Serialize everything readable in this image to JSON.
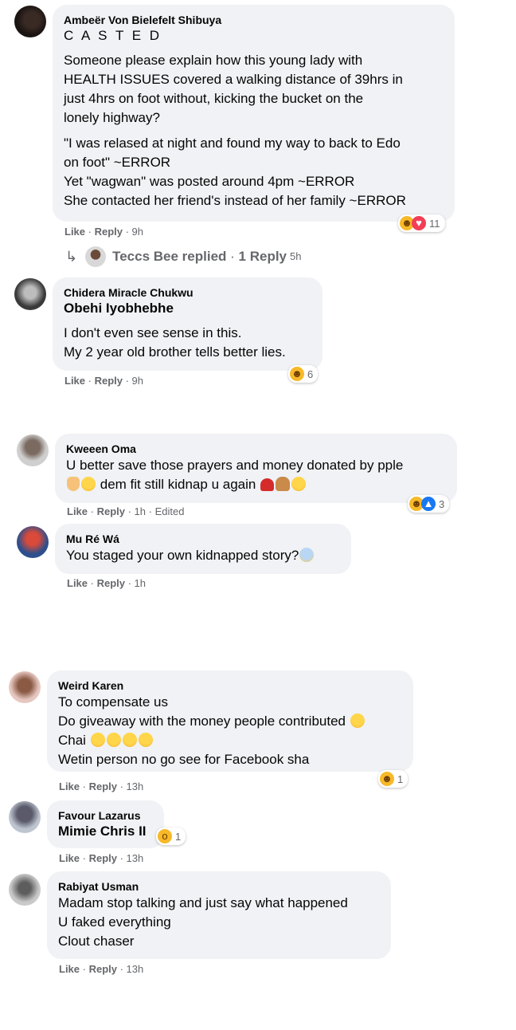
{
  "comments": [
    {
      "author": "Ambeër Von Bielefelt Shibuya",
      "tag": "C A S T E D",
      "paragraphs": [
        [
          "Someone please explain how this young lady with",
          "HEALTH ISSUES covered a walking distance of 39hrs in",
          "just 4hrs on foot without, kicking the bucket on the",
          "lonely highway?"
        ],
        [
          "\"I was relased at night and found my way to back to Edo",
          "on foot\" ~ERROR",
          "Yet \"wagwan\" was posted around 4pm ~ERROR",
          "She contacted her friend's instead of her family ~ERROR"
        ]
      ],
      "like": "Like",
      "reply": "Reply",
      "time": "9h",
      "reactions": "11",
      "replied": {
        "name": "Teccs Bee replied",
        "count": "1 Reply",
        "time": "5h"
      }
    },
    {
      "author": "Chidera Miracle Chukwu",
      "tag": "Obehi Iyobhebhe",
      "lines": [
        "I don't even see sense in this.",
        "My 2 year old brother tells better lies."
      ],
      "like": "Like",
      "reply": "Reply",
      "time": "9h",
      "reactions": "6"
    },
    {
      "author": "Kweeen Oma",
      "line1": "U better save those prayers and money donated by pple",
      "line2": "dem fit still kidnap u again",
      "like": "Like",
      "reply": "Reply",
      "time": "1h",
      "edited": "Edited",
      "reactions": "3"
    },
    {
      "author": "Mu Ré Wá",
      "line1": "You staged your own kidnapped story?",
      "like": "Like",
      "reply": "Reply",
      "time": "1h"
    },
    {
      "author": "Weird Karen",
      "lines": [
        "To compensate us",
        "Do giveaway with the money people contributed",
        "Chai",
        "Wetin person no go see for Facebook sha"
      ],
      "like": "Like",
      "reply": "Reply",
      "time": "13h",
      "reactions": "1"
    },
    {
      "author": "Favour Lazarus",
      "tag": "Mimie Chris II",
      "like": "Like",
      "reply": "Reply",
      "time": "13h",
      "reactions": "1"
    },
    {
      "author": "Rabiyat Usman",
      "lines": [
        "Madam stop talking and just say what happened",
        "U faked everything",
        "Clout chaser"
      ],
      "like": "Like",
      "reply": "Reply",
      "time": "13h"
    }
  ],
  "colors": {
    "bubble": "#f0f2f5",
    "meta": "#65676b",
    "text": "#050505",
    "love": "#f33e58",
    "like": "#1877f2",
    "haha": "#f7b928"
  },
  "icons": [
    "haha-reaction-icon",
    "love-reaction-icon",
    "like-reaction-icon",
    "wow-reaction-icon",
    "reply-arrow-icon"
  ]
}
